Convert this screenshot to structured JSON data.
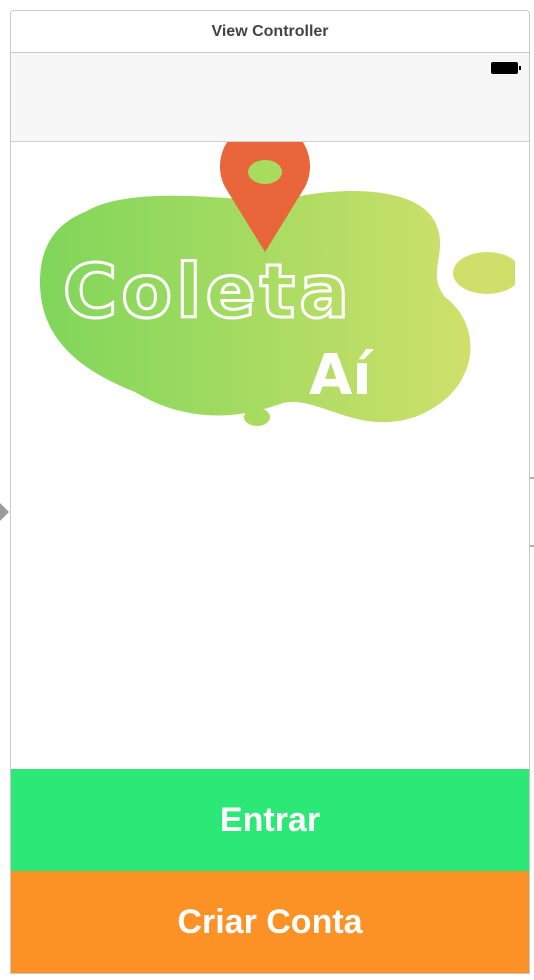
{
  "window": {
    "title": "View Controller"
  },
  "status_bar": {
    "battery_icon": "battery-icon"
  },
  "logo": {
    "text_main": "Coleta",
    "text_sub": "Aí",
    "colors": {
      "blob_start": "#7fd65a",
      "blob_end": "#cfe06a",
      "pin": "#e8663a",
      "text": "#ffffff"
    }
  },
  "buttons": {
    "login_label": "Entrar",
    "signup_label": "Criar Conta",
    "login_color": "#2ce876",
    "signup_color": "#fc9226"
  }
}
